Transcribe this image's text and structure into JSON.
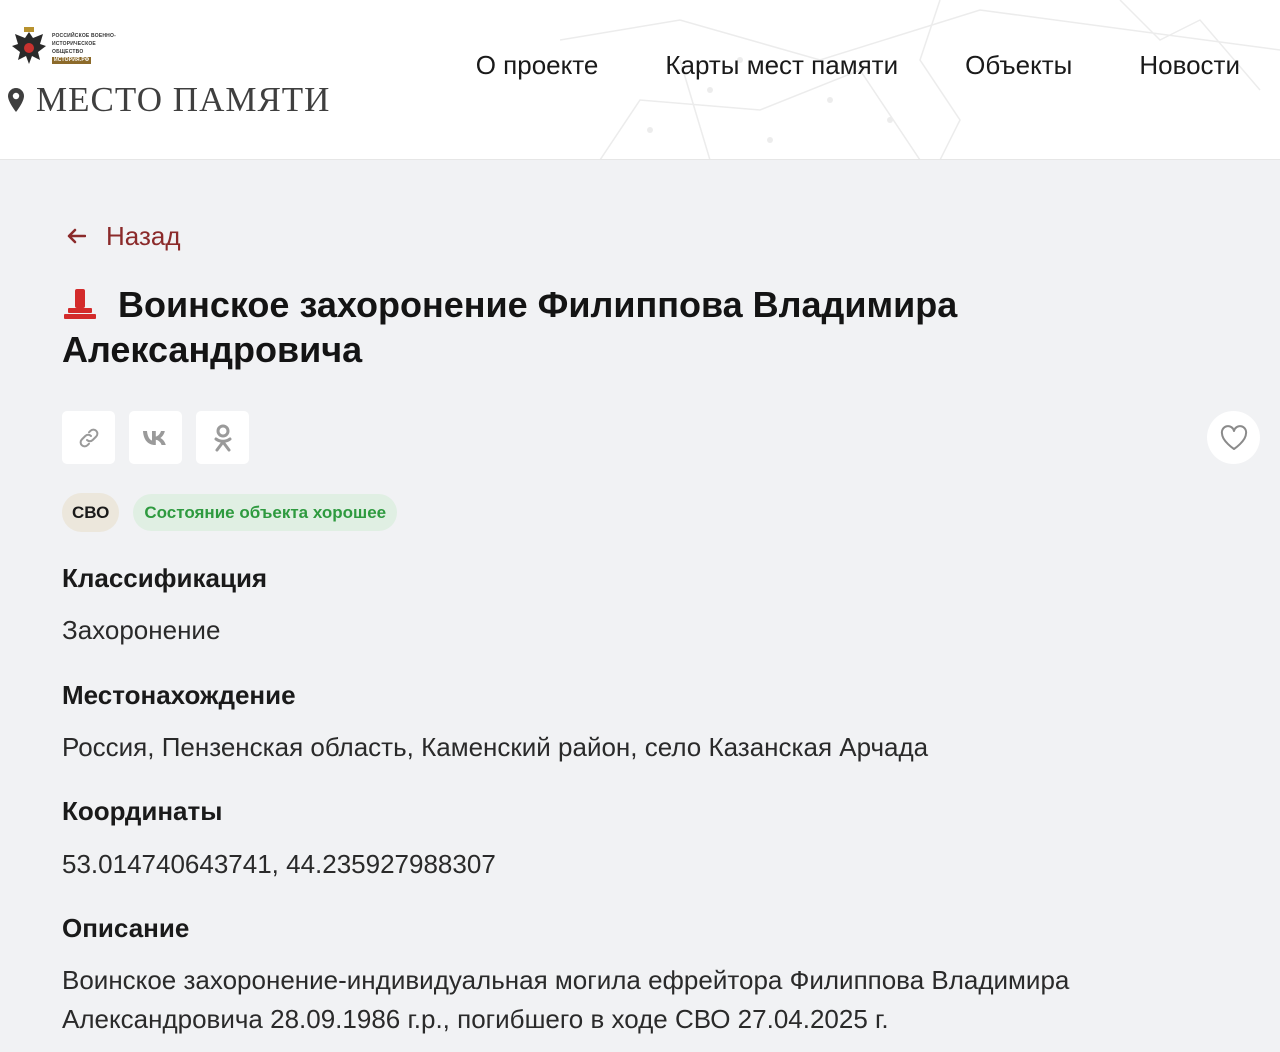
{
  "header": {
    "org_name": "Российское военно-историческое общество",
    "org_tag": "ИСТОРИЯ.РФ",
    "site_name": "МЕСТО ПАМЯТИ",
    "nav": [
      {
        "label": "О проекте"
      },
      {
        "label": "Карты мест памяти"
      },
      {
        "label": "Объекты"
      },
      {
        "label": "Новости"
      }
    ]
  },
  "page": {
    "back_label": "Назад",
    "title": "Воинское захоронение Филиппова Владимира Александровича",
    "share_icons": [
      "link-icon",
      "vk-icon",
      "odnoklassniki-icon"
    ],
    "favorite_icon": "heart-icon",
    "tags": {
      "category": "СВО",
      "state": "Состояние объекта хорошее"
    },
    "fields": [
      {
        "label": "Классификация",
        "value": "Захоронение"
      },
      {
        "label": "Местонахождение",
        "value": "Россия, Пензенская область, Каменский район, село Казанская Арчада"
      },
      {
        "label": "Координаты",
        "value": "53.014740643741, 44.235927988307"
      },
      {
        "label": "Описание",
        "value": "Воинское захоронение-индивидуальная могила ефрейтора Филиппова Владимира Александровича 28.09.1986 г.р., погибшего в ходе СВО 27.04.2025 г."
      }
    ]
  },
  "colors": {
    "accent": "#8b2a2a",
    "monument": "#d32b2b",
    "state_text": "#2e9a3f",
    "state_bg": "#e0efe3",
    "background": "#f1f2f4"
  }
}
